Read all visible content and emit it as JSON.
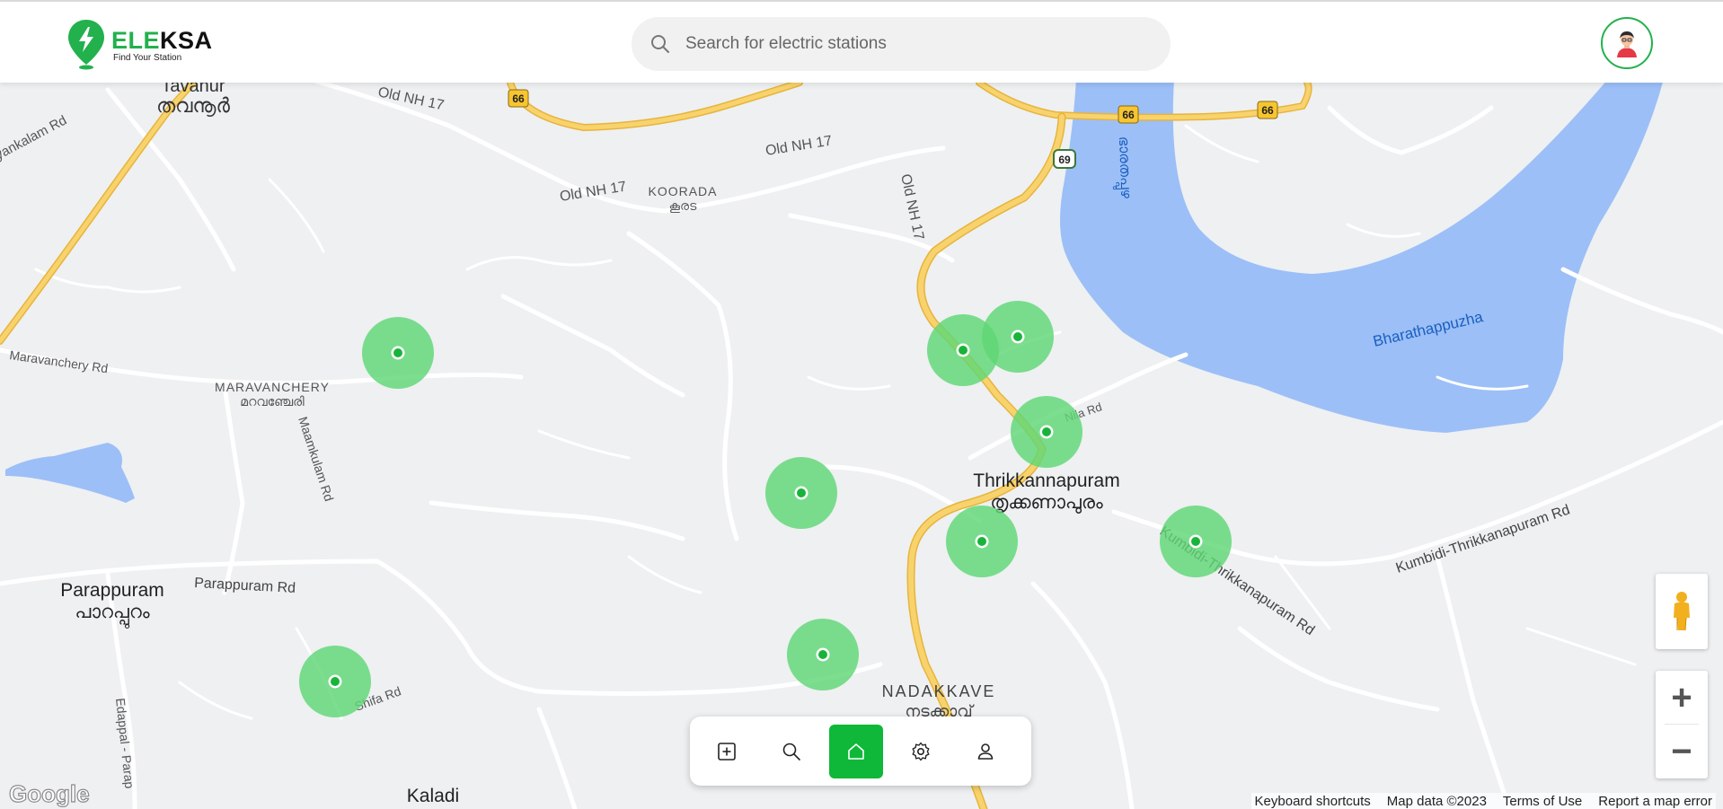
{
  "header": {
    "logo_brand_accent": "ELE",
    "logo_brand_rest": "KSA",
    "logo_tagline": "Find Your Station",
    "search_placeholder": "Search for electric stations"
  },
  "map": {
    "labels": [
      {
        "id": "tavanur",
        "text": "Tavanur"
      },
      {
        "id": "tavanur_ml",
        "text": "തവനൂർ"
      },
      {
        "id": "old_nh17_a",
        "text": "Old NH 17"
      },
      {
        "id": "old_nh17_b",
        "text": "Old NH 17"
      },
      {
        "id": "old_nh17_c",
        "text": "Old NH 17"
      },
      {
        "id": "old_nh17_d",
        "text": "Old NH 17"
      },
      {
        "id": "koorada",
        "text": "KOORADA"
      },
      {
        "id": "koorada_ml",
        "text": "കൂരട"
      },
      {
        "id": "yankalam",
        "text": "yankalam Rd"
      },
      {
        "id": "maravanchery_rd",
        "text": "Maravanchery Rd"
      },
      {
        "id": "maravanchery",
        "text": "MARAVANCHERY"
      },
      {
        "id": "maravanchery_ml",
        "text": "മറവഞ്ചേരി"
      },
      {
        "id": "maamkulam",
        "text": "Maamkulam Rd"
      },
      {
        "id": "thrikkannapuram",
        "text": "Thrikkannapuram"
      },
      {
        "id": "thrikkannapuram_ml",
        "text": "തൃക്കണാപുരം"
      },
      {
        "id": "nila_rd",
        "text": "Nila Rd"
      },
      {
        "id": "river_ml",
        "text": "ഭാരതപ്പുഴ"
      },
      {
        "id": "bharathappuzha",
        "text": "Bharathappuzha"
      },
      {
        "id": "kumbidi_rd_a",
        "text": "Kumbidi-Thrikkanapuram Rd"
      },
      {
        "id": "kumbidi_rd_b",
        "text": "Kumbidi-Thrikkanapuram Rd"
      },
      {
        "id": "parappuram",
        "text": "Parappuram"
      },
      {
        "id": "parappuram_ml",
        "text": "പാറപ്പുറം"
      },
      {
        "id": "parappuram_rd",
        "text": "Parappuram Rd"
      },
      {
        "id": "edappal_rd",
        "text": "Edappal - Parap"
      },
      {
        "id": "shifa_rd",
        "text": "Shifa Rd"
      },
      {
        "id": "nadakkave",
        "text": "NADAKKAVE"
      },
      {
        "id": "nadakkave_ml",
        "text": "നടക്കാവ്"
      },
      {
        "id": "kaladi",
        "text": "Kaladi"
      }
    ],
    "shields": [
      {
        "id": "s66a",
        "text": "66"
      },
      {
        "id": "s66b",
        "text": "66"
      },
      {
        "id": "s66c",
        "text": "66"
      },
      {
        "id": "s69",
        "text": "69"
      }
    ],
    "station_count": 10
  },
  "nav": {
    "items": [
      {
        "id": "add",
        "icon": "plus-square-icon",
        "active": false
      },
      {
        "id": "search",
        "icon": "search-icon",
        "active": false
      },
      {
        "id": "home",
        "icon": "home-icon",
        "active": true
      },
      {
        "id": "settings",
        "icon": "gear-icon",
        "active": false
      },
      {
        "id": "profile",
        "icon": "user-icon",
        "active": false
      }
    ]
  },
  "controls": {
    "zoom_in_label": "+",
    "zoom_out_label": "−"
  },
  "footer": {
    "google_logo": "Google",
    "keyboard_shortcuts": "Keyboard shortcuts",
    "map_data": "Map data ©2023",
    "terms": "Terms of Use",
    "report": "Report a map error"
  },
  "colors": {
    "accent": "#22b14c",
    "station_halo": "#5fd775",
    "station_dot": "#18b43a",
    "water": "#9cbff7",
    "highway": "#f6c445",
    "road": "#ffffff",
    "land": "#eef0f2"
  }
}
